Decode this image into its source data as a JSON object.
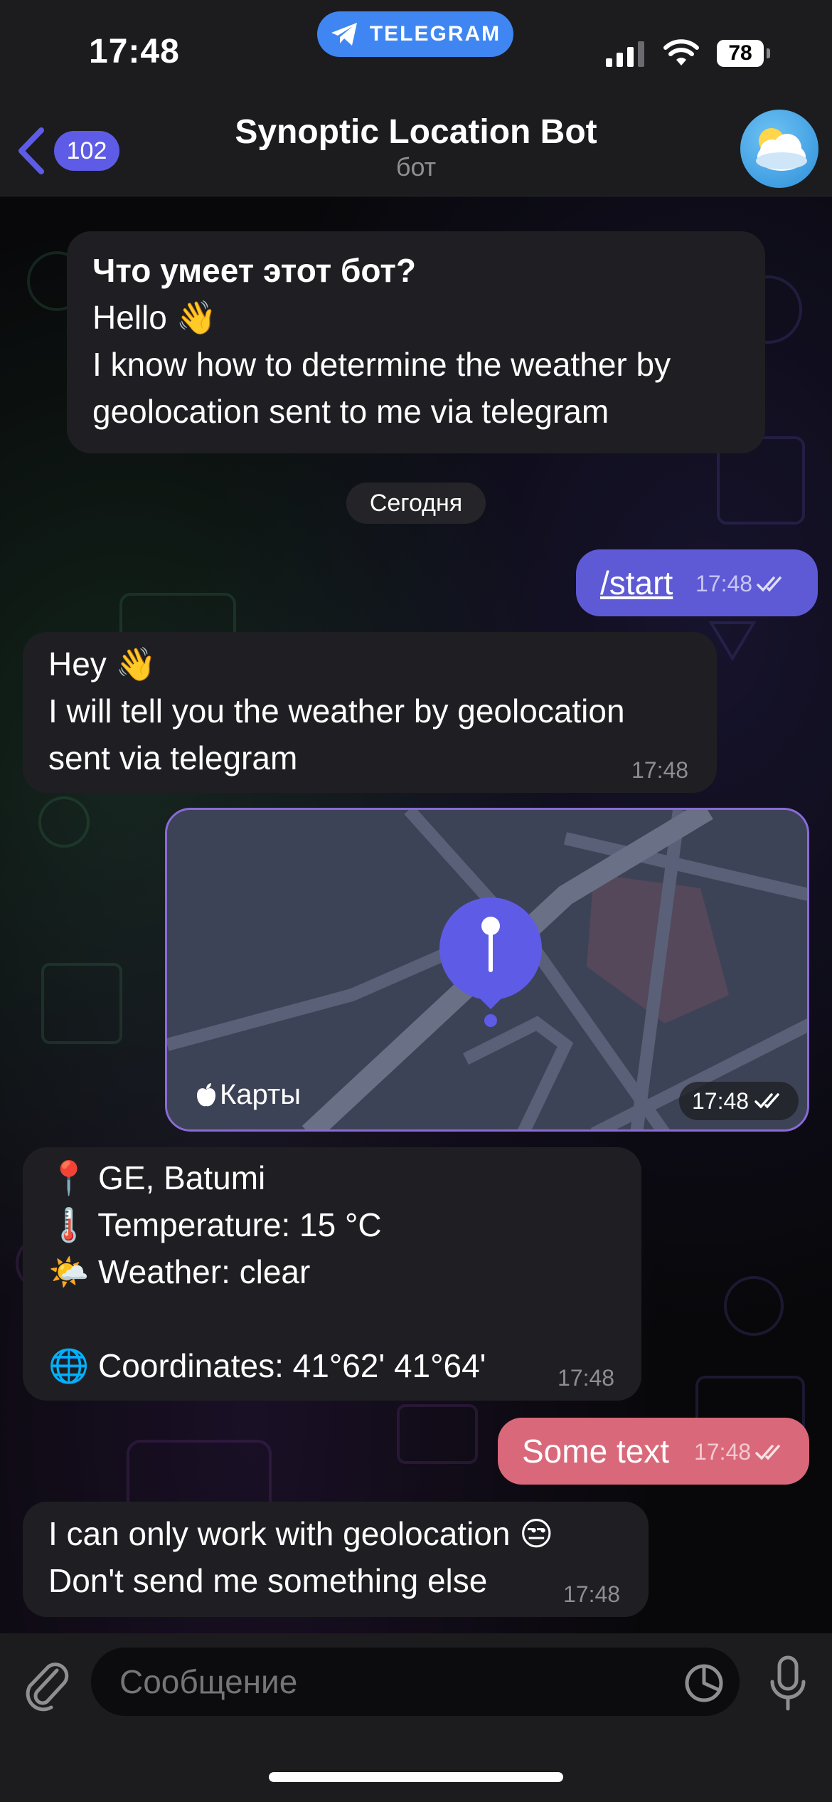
{
  "status_bar": {
    "time": "17:48",
    "app_pill": "TELEGRAM",
    "battery": "78"
  },
  "header": {
    "back_count": "102",
    "title": "Synoptic Location Bot",
    "subtitle": "бот"
  },
  "messages": {
    "intro": {
      "heading": "Что умеет этот бот?",
      "body": "Hello 👋\nI know how to determine the weather by geolocation sent to me via telegram"
    },
    "date_chip": "Сегодня",
    "start_cmd": {
      "text": "/start",
      "time": "17:48"
    },
    "hey": {
      "text": "Hey 👋\nI will tell you the weather by geolocation sent via telegram",
      "time": "17:48"
    },
    "location": {
      "brand": "Карты",
      "time": "17:48"
    },
    "weather": {
      "line1": "📍 GE, Batumi",
      "line2": "🌡️ Temperature: 15 °C",
      "line3": "🌤️ Weather: clear",
      "line4": "🌐 Coordinates: 41°62' 41°64'",
      "time": "17:48"
    },
    "some_text": {
      "text": "Some text",
      "time": "17:48"
    },
    "only_geo": {
      "text": "I can only work with geolocation 😒\nDon't send me something else",
      "time": "17:48"
    }
  },
  "composer": {
    "placeholder": "Сообщение"
  },
  "colors": {
    "accent": "#5e5ce6",
    "outgoing": "#5e5ad6",
    "outgoing_alt": "#d9697a",
    "incoming": "#1f1f23",
    "telegram_blue": "#3f86f2"
  },
  "icons": {
    "back": "chevron-left-icon",
    "attach": "paperclip-icon",
    "sticker": "sticker-icon",
    "mic": "microphone-icon",
    "read": "double-check-icon",
    "telegram": "telegram-plane-icon"
  }
}
